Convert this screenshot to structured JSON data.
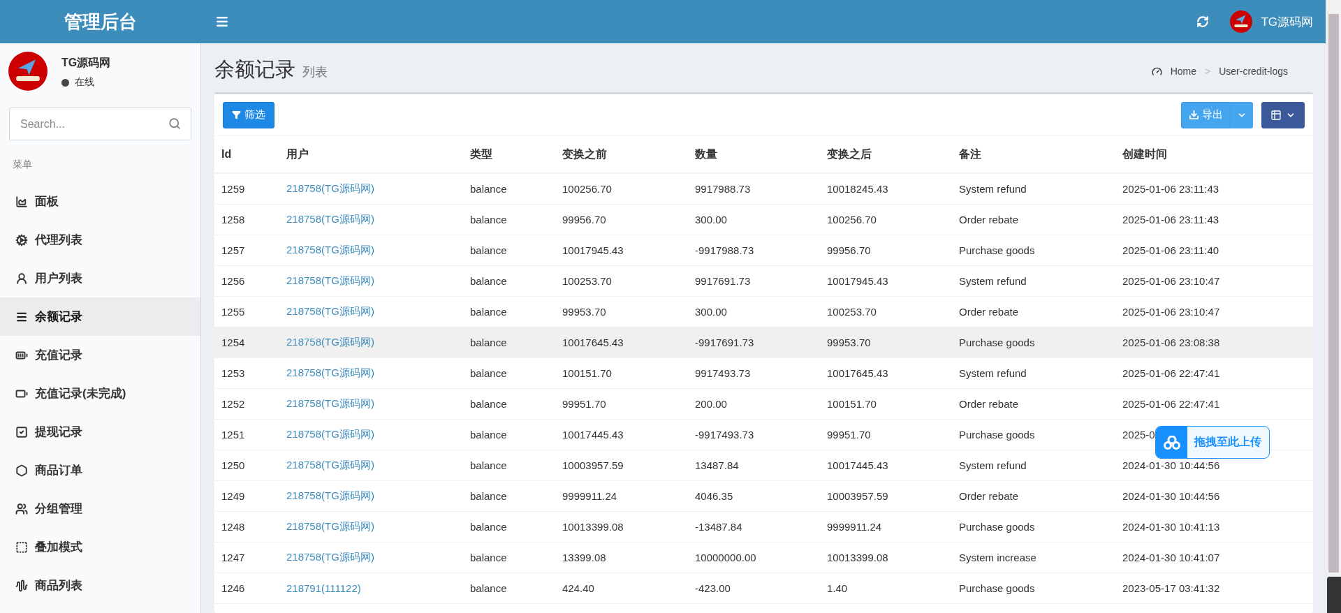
{
  "header": {
    "brand": "管理后台",
    "user_name": "TG源码网"
  },
  "sidebar": {
    "user_name": "TG源码网",
    "status": "在线",
    "search": {
      "placeholder": "Search..."
    },
    "section": "菜单",
    "items": [
      {
        "label": "面板",
        "selected": false
      },
      {
        "label": "代理列表",
        "selected": false
      },
      {
        "label": "用户列表",
        "selected": false
      },
      {
        "label": "余额记录",
        "selected": true
      },
      {
        "label": "充值记录",
        "selected": false
      },
      {
        "label": "充值记录(未完成)",
        "selected": false
      },
      {
        "label": "提现记录",
        "selected": false
      },
      {
        "label": "商品订单",
        "selected": false
      },
      {
        "label": "分组管理",
        "selected": false
      },
      {
        "label": "叠加模式",
        "selected": false
      },
      {
        "label": "商品列表",
        "selected": false
      }
    ]
  },
  "page": {
    "title": "余额记录",
    "subtitle": "列表",
    "breadcrumb": [
      "Home",
      "User-credit-logs"
    ],
    "breadcrumb_separator": ">"
  },
  "toolbar": {
    "filter": "筛选",
    "export": "导出"
  },
  "table": {
    "columns": [
      "Id",
      "用户",
      "类型",
      "变换之前",
      "数量",
      "变换之后",
      "备注",
      "创建时间"
    ],
    "rows": [
      {
        "cells": [
          "1259",
          "218758(TG源码网)",
          "balance",
          "100256.70",
          "9917988.73",
          "10018245.43",
          "System refund",
          "2025-01-06 23:11:43"
        ],
        "hovered": false
      },
      {
        "cells": [
          "1258",
          "218758(TG源码网)",
          "balance",
          "99956.70",
          "300.00",
          "100256.70",
          "Order rebate",
          "2025-01-06 23:11:43"
        ],
        "hovered": false
      },
      {
        "cells": [
          "1257",
          "218758(TG源码网)",
          "balance",
          "10017945.43",
          "-9917988.73",
          "99956.70",
          "Purchase goods",
          "2025-01-06 23:11:40"
        ],
        "hovered": false
      },
      {
        "cells": [
          "1256",
          "218758(TG源码网)",
          "balance",
          "100253.70",
          "9917691.73",
          "10017945.43",
          "System refund",
          "2025-01-06 23:10:47"
        ],
        "hovered": false
      },
      {
        "cells": [
          "1255",
          "218758(TG源码网)",
          "balance",
          "99953.70",
          "300.00",
          "100253.70",
          "Order rebate",
          "2025-01-06 23:10:47"
        ],
        "hovered": false
      },
      {
        "cells": [
          "1254",
          "218758(TG源码网)",
          "balance",
          "10017645.43",
          "-9917691.73",
          "99953.70",
          "Purchase goods",
          "2025-01-06 23:08:38"
        ],
        "hovered": true
      },
      {
        "cells": [
          "1253",
          "218758(TG源码网)",
          "balance",
          "100151.70",
          "9917493.73",
          "10017645.43",
          "System refund",
          "2025-01-06 22:47:41"
        ],
        "hovered": false
      },
      {
        "cells": [
          "1252",
          "218758(TG源码网)",
          "balance",
          "99951.70",
          "200.00",
          "100151.70",
          "Order rebate",
          "2025-01-06 22:47:41"
        ],
        "hovered": false
      },
      {
        "cells": [
          "1251",
          "218758(TG源码网)",
          "balance",
          "10017445.43",
          "-9917493.73",
          "99951.70",
          "Purchase goods",
          "2025-0"
        ],
        "hovered": false
      },
      {
        "cells": [
          "1250",
          "218758(TG源码网)",
          "balance",
          "10003957.59",
          "13487.84",
          "10017445.43",
          "System refund",
          "2024-01-30 10:44:56"
        ],
        "hovered": false
      },
      {
        "cells": [
          "1249",
          "218758(TG源码网)",
          "balance",
          "9999911.24",
          "4046.35",
          "10003957.59",
          "Order rebate",
          "2024-01-30 10:44:56"
        ],
        "hovered": false
      },
      {
        "cells": [
          "1248",
          "218758(TG源码网)",
          "balance",
          "10013399.08",
          "-13487.84",
          "9999911.24",
          "Purchase goods",
          "2024-01-30 10:41:13"
        ],
        "hovered": false
      },
      {
        "cells": [
          "1247",
          "218758(TG源码网)",
          "balance",
          "13399.08",
          "10000000.00",
          "10013399.08",
          "System increase",
          "2024-01-30 10:41:07"
        ],
        "hovered": false
      },
      {
        "cells": [
          "1246",
          "218791(111122)",
          "balance",
          "424.40",
          "-423.00",
          "1.40",
          "Purchase goods",
          "2023-05-17 03:41:32"
        ],
        "hovered": false
      }
    ]
  },
  "upload_badge": {
    "label": "拖拽至此上传"
  }
}
